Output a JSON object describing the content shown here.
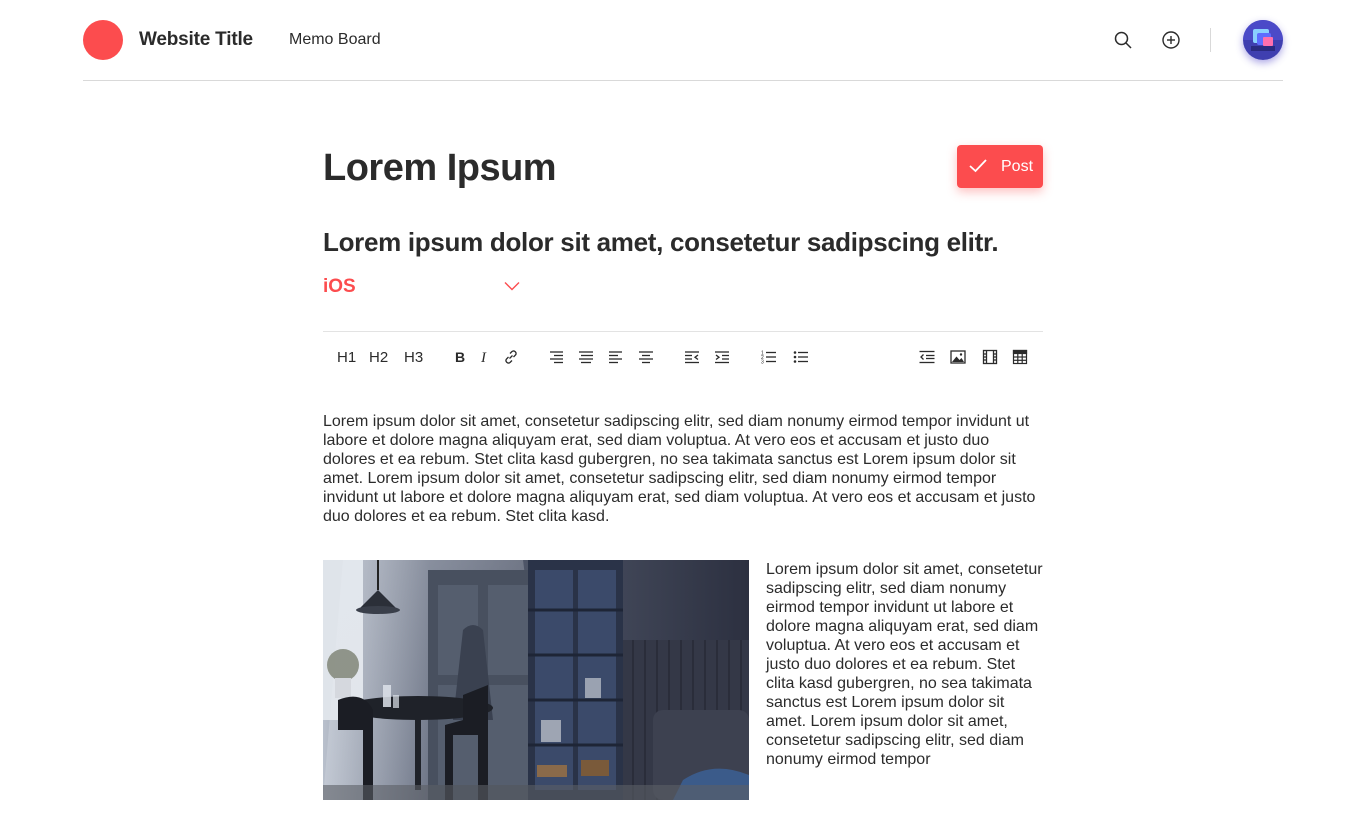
{
  "header": {
    "site_title": "Website Title",
    "nav_link": "Memo Board",
    "logo_color": "#fc4c4e",
    "icons": [
      "search-icon",
      "add-circle-icon"
    ]
  },
  "editor": {
    "title": "Lorem Ipsum",
    "post_label": "Post",
    "subtitle": "Lorem ipsum dolor sit amet, consetetur sadipscing elitr.",
    "category": "iOS",
    "accent_color": "#fc4c4e",
    "toolbar": {
      "headings": [
        "H1",
        "H2",
        "H3"
      ],
      "icons": [
        "bold-icon",
        "italic-icon",
        "link-icon",
        "align-right-icon",
        "align-justify-icon",
        "align-left-icon",
        "align-center-icon",
        "outdent-icon",
        "indent-icon",
        "ordered-list-icon",
        "bullet-list-icon",
        "quote-block-icon",
        "image-icon",
        "video-icon",
        "table-icon"
      ]
    },
    "body_paragraph": "Lorem ipsum dolor sit amet, consetetur sadipscing elitr, sed diam nonumy eirmod tempor invidunt ut labore et dolore magna aliquyam erat, sed diam voluptua. At vero eos et accusam et justo duo dolores et ea rebum. Stet clita kasd gubergren, no sea takimata sanctus est Lorem ipsum dolor sit amet. Lorem ipsum dolor sit amet, consetetur sadipscing elitr, sed diam nonumy eirmod tempor invidunt ut labore et dolore magna aliquyam erat, sed diam voluptua. At vero eos et accusam et justo duo dolores et ea rebum. Stet clita kasd.",
    "side_paragraph": "Lorem ipsum dolor sit amet, consetetur sadipscing elitr, sed diam nonumy eirmod tempor invidunt ut labore et dolore magna aliquyam erat, sed diam voluptua. At vero eos et accusam et justo duo dolores et ea rebum. Stet clita kasd gubergren, no sea takimata sanctus est Lorem ipsum dolor sit amet. Lorem ipsum dolor sit amet, consetetur sadipscing elitr, sed diam nonumy eirmod tempor"
  }
}
